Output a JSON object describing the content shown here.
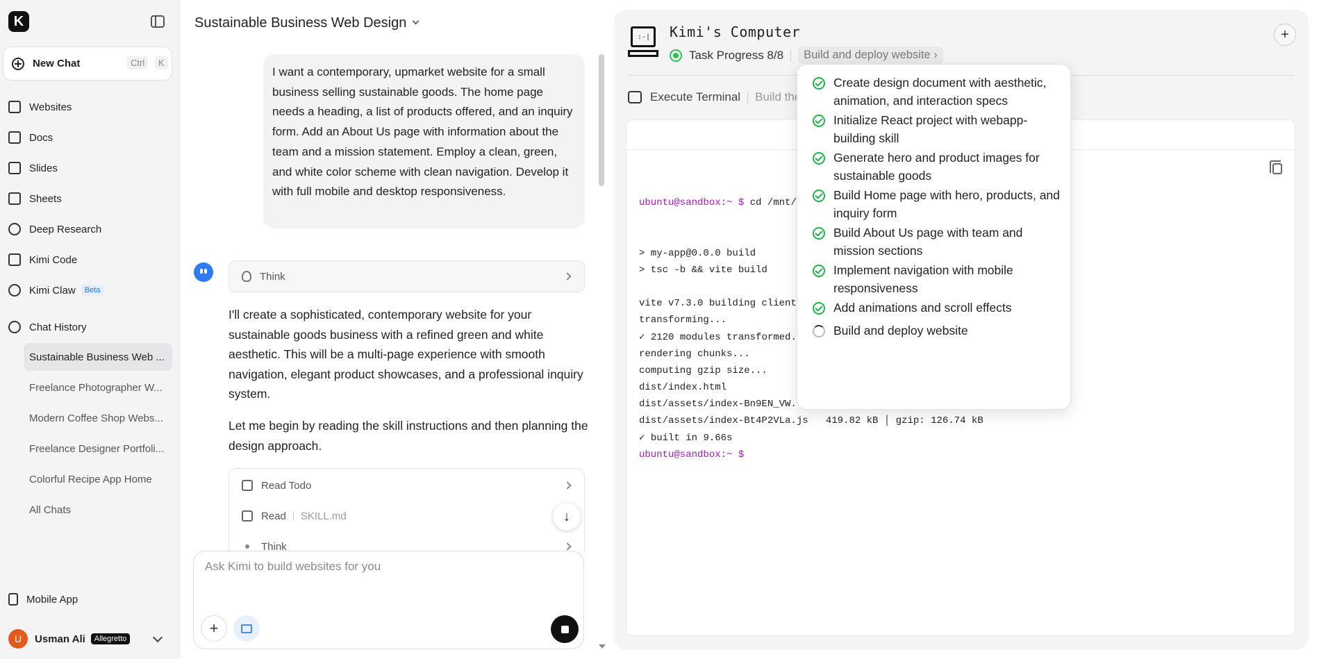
{
  "sidebar": {
    "logo": "K",
    "new_chat": {
      "label": "New Chat",
      "shortcut_mod": "Ctrl",
      "shortcut_key": "K"
    },
    "nav": [
      {
        "label": "Websites",
        "icon": "browser-window-icon"
      },
      {
        "label": "Docs",
        "icon": "document-icon"
      },
      {
        "label": "Slides",
        "icon": "presentation-icon"
      },
      {
        "label": "Sheets",
        "icon": "table-icon"
      },
      {
        "label": "Deep Research",
        "icon": "research-icon"
      },
      {
        "label": "Kimi Code",
        "icon": "code-terminal-icon"
      },
      {
        "label": "Kimi Claw",
        "icon": "claw-icon",
        "badge": "Beta"
      }
    ],
    "history_label": "Chat History",
    "history": [
      "Sustainable Business Web ...",
      "Freelance Photographer W...",
      "Modern Coffee Shop Webs...",
      "Freelance Designer Portfoli...",
      "Colorful Recipe App Home",
      "All Chats"
    ],
    "mobile_app": "Mobile App",
    "user": {
      "initial": "U",
      "name": "Usman Ali",
      "plan": "Allegretto"
    }
  },
  "chat": {
    "title": "Sustainable Business Web Design",
    "user_message": "I want a contemporary, upmarket website for a small business selling sustainable goods. The home page needs a heading, a list of products offered, and an inquiry form. Add an About Us page with information about the team and a mission statement. Employ a clean, green, and white color scheme with clean navigation. Develop it with full mobile and desktop responsiveness.",
    "think_label": "Think",
    "ai_paragraph_1": "I'll create a sophisticated, contemporary website for your sustainable goods business with a refined green and white aesthetic. This will be a multi-page experience with smooth navigation, elegant product showcases, and a professional inquiry system.",
    "ai_paragraph_2": "Let me begin by reading the skill instructions and then planning the design approach.",
    "tools": [
      {
        "label": "Read Todo",
        "detail": ""
      },
      {
        "label": "Read",
        "detail": "SKILL.md"
      },
      {
        "label": "Think",
        "detail": ""
      }
    ],
    "composer_placeholder": "Ask Kimi to build websites for you"
  },
  "computer": {
    "title": "Kimi's Computer",
    "task_progress": "Task Progress 8/8",
    "current_step": "Build and deploy website",
    "exec_label": "Execute Terminal",
    "exec_detail": "Build the",
    "terminal_lines": [
      {
        "prompt": "ubuntu@sandbox:~ $",
        "text": " cd /mnt/"
      },
      {
        "prompt": "",
        "text": ""
      },
      {
        "prompt": "",
        "text": ""
      },
      {
        "prompt": "",
        "text": "> my-app@0.0.0 build"
      },
      {
        "prompt": "",
        "text": "> tsc -b && vite build"
      },
      {
        "prompt": "",
        "text": ""
      },
      {
        "prompt": "",
        "text": "vite v7.3.0 building client"
      },
      {
        "prompt": "",
        "text": "transforming..."
      },
      {
        "prompt": "",
        "text": "✓ 2120 modules transformed."
      },
      {
        "prompt": "",
        "text": "rendering chunks..."
      },
      {
        "prompt": "",
        "text": "computing gzip size..."
      },
      {
        "prompt": "",
        "text": "dist/index.html"
      },
      {
        "prompt": "",
        "text": "dist/assets/index-Bn9EN_VW."
      },
      {
        "prompt": "",
        "text": "dist/assets/index-Bt4P2VLa.js   419.82 kB │ gzip: 126.74 kB"
      },
      {
        "prompt": "",
        "text": "✓ built in 9.66s"
      },
      {
        "prompt": "ubuntu@sandbox:~ $",
        "text": ""
      }
    ],
    "tasks": [
      {
        "text": "Create design document with aesthetic, animation, and interaction specs",
        "done": true
      },
      {
        "text": "Initialize React project with webapp-building skill",
        "done": true
      },
      {
        "text": "Generate hero and product images for sustainable goods",
        "done": true
      },
      {
        "text": "Build Home page with hero, products, and inquiry form",
        "done": true
      },
      {
        "text": "Build About Us page with team and mission sections",
        "done": true
      },
      {
        "text": "Implement navigation with mobile responsiveness",
        "done": true
      },
      {
        "text": "Add animations and scroll effects",
        "done": true
      },
      {
        "text": "Build and deploy website",
        "done": false
      }
    ]
  },
  "colors": {
    "accent_green": "#22b24c",
    "prompt_purple": "#a31ab0",
    "ai_blue": "#2f7bf5"
  }
}
